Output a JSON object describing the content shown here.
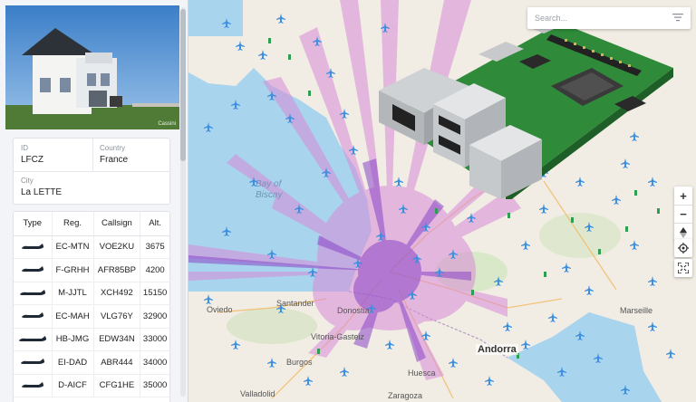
{
  "panel": {
    "photo_credit": "Cassini",
    "station": {
      "id_label": "ID",
      "id_value": "LFCZ",
      "country_label": "Country",
      "country_value": "France",
      "city_label": "City",
      "city_value": "La LETTE"
    },
    "table": {
      "headers": {
        "type": "Type",
        "reg": "Reg.",
        "callsign": "Callsign",
        "alt": "Alt."
      },
      "rows": [
        {
          "reg": "EC-MTN",
          "callsign": "VOE2KU",
          "alt": "3675"
        },
        {
          "reg": "F-GRHH",
          "callsign": "AFR85BP",
          "alt": "4200"
        },
        {
          "reg": "M-JJTL",
          "callsign": "XCH492",
          "alt": "15150"
        },
        {
          "reg": "EC-MAH",
          "callsign": "VLG76Y",
          "alt": "32900"
        },
        {
          "reg": "HB-JMG",
          "callsign": "EDW34N",
          "alt": "33000"
        },
        {
          "reg": "EI-DAD",
          "callsign": "ABR444",
          "alt": "34000"
        },
        {
          "reg": "D-AICF",
          "callsign": "CFG1HE",
          "alt": "35000"
        }
      ]
    }
  },
  "search": {
    "placeholder": "Search...",
    "value": ""
  },
  "map": {
    "labels": {
      "bay1": "Bay of",
      "bay2": "Biscay",
      "santander": "Santander",
      "oviedo": "Oviedo",
      "donostia": "Donostia",
      "vitoria": "Vitoria-Gasteiz",
      "burgos": "Burgos",
      "huesca": "Huesca",
      "zaragoza": "Zaragoza",
      "valladolid": "Valladolid",
      "andorra": "Andorra",
      "marseille": "Marseille"
    }
  },
  "controls": {
    "zoom_in": "+",
    "zoom_out": "−"
  },
  "colors": {
    "sea": "#a8d4ee",
    "land": "#f1ede4",
    "coverage_pink": "#d98ad8",
    "coverage_purple": "#8b47c8",
    "plane": "#3d8fe0",
    "panel_bg": "#f2f4f7"
  }
}
